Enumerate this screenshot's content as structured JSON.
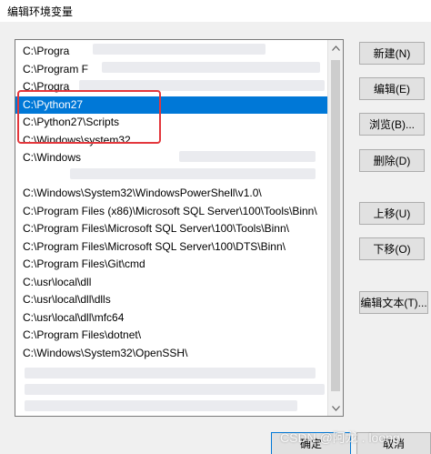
{
  "window": {
    "title": "编辑环境变量"
  },
  "list": {
    "items": [
      {
        "text": "C:\\Progra",
        "selected": false
      },
      {
        "text": "C:\\Program F",
        "selected": false
      },
      {
        "text": "C:\\Progra",
        "selected": false
      },
      {
        "text": "C:\\Python27",
        "selected": true
      },
      {
        "text": "C:\\Python27\\Scripts",
        "selected": false
      },
      {
        "text": "C:\\Windows\\system32",
        "selected": false
      },
      {
        "text": "C:\\Windows",
        "selected": false
      },
      {
        "text": "",
        "selected": false
      },
      {
        "text": "C:\\Windows\\System32\\WindowsPowerShell\\v1.0\\",
        "selected": false
      },
      {
        "text": "C:\\Program Files (x86)\\Microsoft SQL Server\\100\\Tools\\Binn\\",
        "selected": false
      },
      {
        "text": "C:\\Program Files\\Microsoft SQL Server\\100\\Tools\\Binn\\",
        "selected": false
      },
      {
        "text": "C:\\Program Files\\Microsoft SQL Server\\100\\DTS\\Binn\\",
        "selected": false
      },
      {
        "text": "C:\\Program Files\\Git\\cmd",
        "selected": false
      },
      {
        "text": "C:\\usr\\local\\dll",
        "selected": false
      },
      {
        "text": "C:\\usr\\local\\dll\\dlls",
        "selected": false
      },
      {
        "text": "C:\\usr\\local\\dll\\mfc64",
        "selected": false
      },
      {
        "text": "C:\\Program Files\\dotnet\\",
        "selected": false
      },
      {
        "text": "C:\\Windows\\System32\\OpenSSH\\",
        "selected": false
      }
    ]
  },
  "buttons": {
    "new": "新建(N)",
    "edit": "编辑(E)",
    "browse": "浏览(B)...",
    "delete": "删除(D)",
    "move_up": "上移(U)",
    "move_down": "下移(O)",
    "edit_text": "编辑文本(T)...",
    "ok": "确定",
    "cancel": "取消"
  },
  "watermark": "CSDN @阿龙 . loong",
  "colors": {
    "selection": "#0078d7",
    "highlight_box": "#e3373c",
    "button_face": "#e1e1e1"
  },
  "icons": {
    "scroll_up": "chevron-up-icon",
    "scroll_down": "chevron-down-icon"
  }
}
